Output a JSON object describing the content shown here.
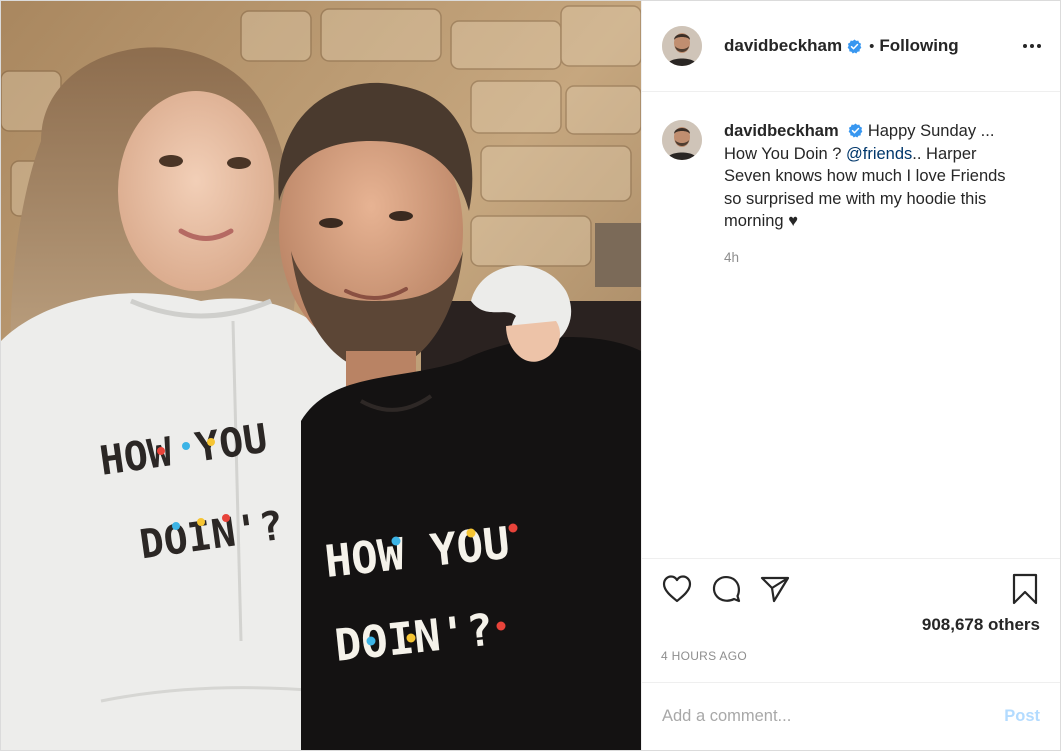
{
  "post": {
    "username": "davidbeckham",
    "follow_state": "Following",
    "separator": "•",
    "caption": {
      "username": "davidbeckham",
      "text_before_mention": "Happy Sunday ... How You Doin ? ",
      "mention": "@friends",
      "text_after_mention": ".. Harper Seven knows how much I love Friends so surprised me with my hoodie this morning ♥",
      "relative_time": "4h"
    },
    "likes_text": "908,678 others",
    "date_text": "4 HOURS AGO",
    "comment": {
      "placeholder": "Add a comment...",
      "value": "",
      "post_label": "Post"
    },
    "photo": {
      "girl_shirt": {
        "line1": "HOW YOU",
        "line2": "DOIN'?"
      },
      "man_shirt": {
        "line1": "HOW YOU",
        "line2": "DOIN'?"
      }
    }
  },
  "icons": {
    "verified": "verified-badge-icon",
    "more": "more-options-icon",
    "like": "heart-icon",
    "comment": "comment-bubble-icon",
    "share": "paper-plane-icon",
    "save": "bookmark-icon"
  },
  "colors": {
    "verified_blue": "#3897f0",
    "mention": "#00376b",
    "muted_text": "#8e8e8e",
    "post_button_disabled": "#b3dbff"
  }
}
